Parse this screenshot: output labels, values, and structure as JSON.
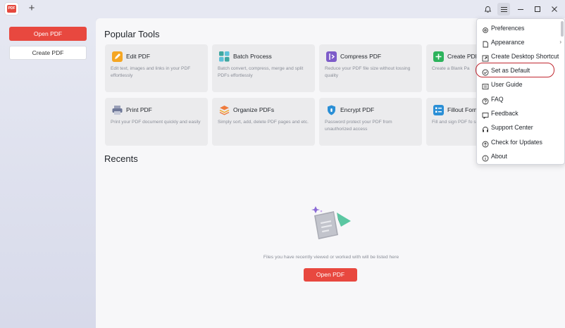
{
  "titlebar": {
    "app_icon_text": "PDF",
    "new_tab_symbol": "+",
    "icons": [
      "bell-icon",
      "menu-icon",
      "minimize-icon",
      "maximize-icon",
      "close-icon"
    ]
  },
  "sidebar": {
    "open_pdf": "Open PDF",
    "create_pdf": "Create PDF"
  },
  "popular_tools": {
    "title": "Popular Tools",
    "tools": [
      {
        "name": "Edit PDF",
        "desc": "Edit text, images and links in your PDF effortlessly",
        "color": "#f5a623"
      },
      {
        "name": "Batch Process",
        "desc": "Batch convert, compress, merge and split PDFs effortlessly",
        "color": "#3fa7a0"
      },
      {
        "name": "Compress PDF",
        "desc": "Reduce your PDF file size without lossing quality",
        "color": "#7d5cc9"
      },
      {
        "name": "Create PDF",
        "desc": "Create a Blank Pa",
        "color": "#2db35c"
      },
      {
        "name": "Print PDF",
        "desc": "Print your PDF document quickly and easily",
        "color": "#7a82a0"
      },
      {
        "name": "Organize PDFs",
        "desc": "Simply sort, add, delete PDF pages and etc.",
        "color": "#ef7b3d"
      },
      {
        "name": "Encrypt PDF",
        "desc": "Password protect your PDF from unauthorized access",
        "color": "#2b8fd6"
      },
      {
        "name": "Fillout Form",
        "desc": "Fill and sign PDF fo securely",
        "color": "#2b8fd6"
      }
    ]
  },
  "recents": {
    "title": "Recents",
    "empty_text": "Files you have recently viewed or worked with will be listed here",
    "open_pdf": "Open PDF"
  },
  "menu": {
    "items": [
      {
        "label": "Preferences",
        "icon": "gear-icon",
        "submenu": false
      },
      {
        "label": "Appearance",
        "icon": "appearance-icon",
        "submenu": true
      },
      {
        "label": "Create Desktop Shortcut",
        "icon": "shortcut-icon",
        "submenu": false
      },
      {
        "label": "Set as Default",
        "icon": "check-circle-icon",
        "submenu": false
      },
      {
        "label": "User Guide",
        "icon": "book-icon",
        "submenu": false
      },
      {
        "label": "FAQ",
        "icon": "question-icon",
        "submenu": false
      },
      {
        "label": "Feedback",
        "icon": "feedback-icon",
        "submenu": false
      },
      {
        "label": "Support Center",
        "icon": "headset-icon",
        "submenu": false
      },
      {
        "label": "Check for Updates",
        "icon": "update-icon",
        "submenu": false
      },
      {
        "label": "About",
        "icon": "info-icon",
        "submenu": false
      }
    ],
    "highlight_color": "#c0272f"
  },
  "colors": {
    "accent": "#e8483f"
  }
}
